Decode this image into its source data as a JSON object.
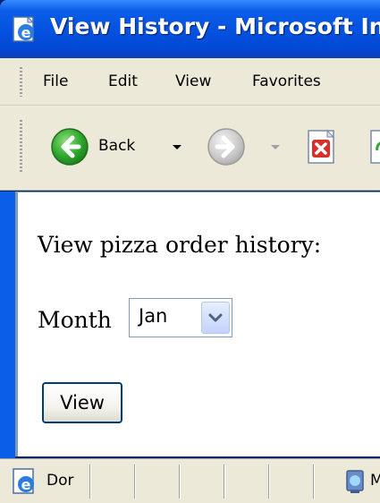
{
  "window": {
    "title": "View History - Microsoft In"
  },
  "menubar": {
    "items": [
      "File",
      "Edit",
      "View",
      "Favorites"
    ]
  },
  "toolbar": {
    "back_label": "Back"
  },
  "page": {
    "heading": "View pizza order history:",
    "month_label": "Month",
    "month_select": {
      "value": "Jan"
    },
    "view_button": "View"
  },
  "statusbar": {
    "status_text": "Dor",
    "zone_text": "M"
  },
  "colors": {
    "titlebar": "#0453e0",
    "chrome": "#ece9d8",
    "field_border": "#7f9db9",
    "button_border": "#003c74"
  },
  "icons": {
    "title": "ie-page-icon",
    "back": "back-arrow-icon",
    "forward": "forward-arrow-icon",
    "stop": "stop-icon",
    "refresh": "refresh-icon",
    "status": "ie-page-icon",
    "zone": "internet-zone-icon"
  }
}
